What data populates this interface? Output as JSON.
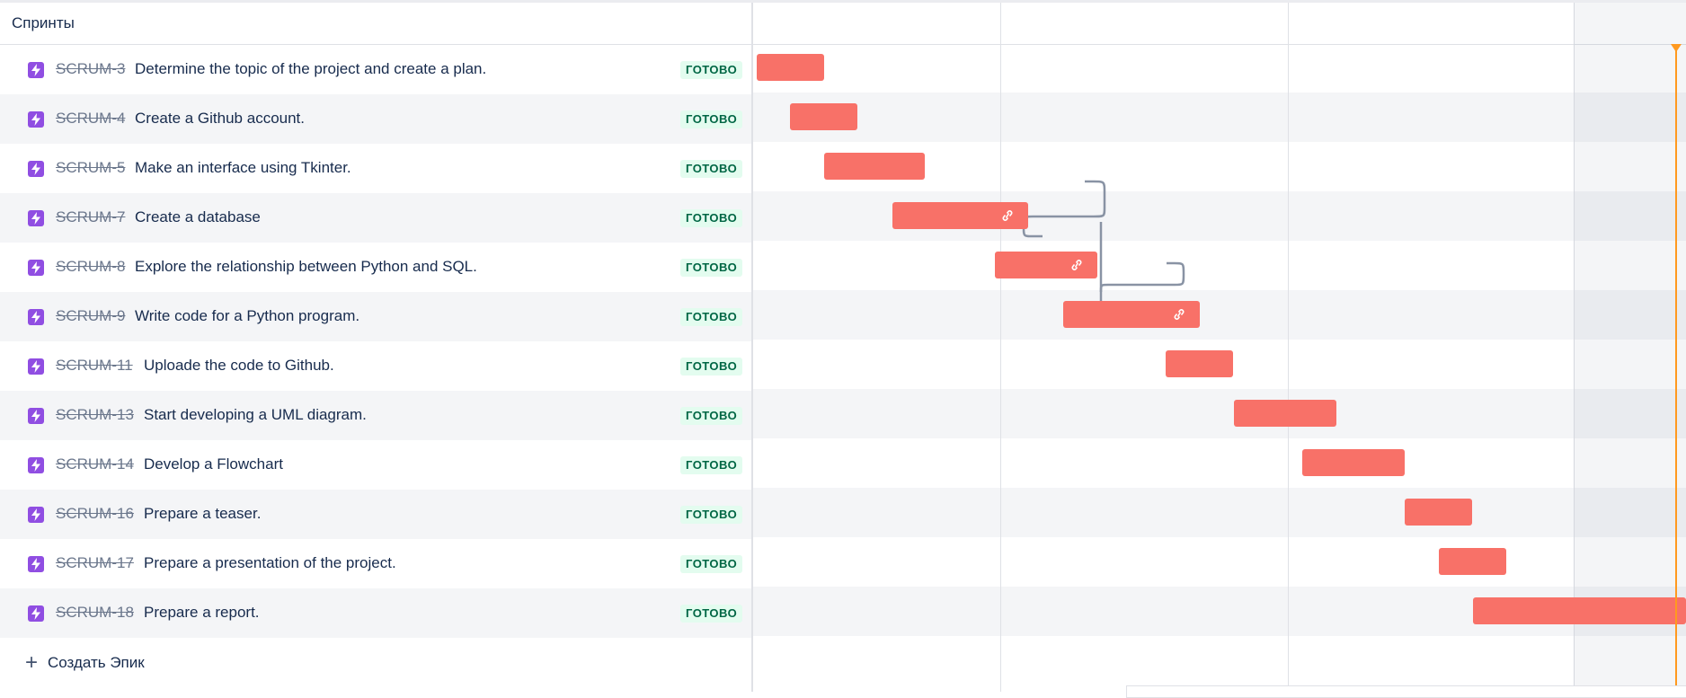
{
  "list_header": "Спринты",
  "status_done": "ГОТОВО",
  "create_epic_label": "Создать Эпик",
  "issue_icon": "epic-lightning-icon",
  "link_icon": "link-icon",
  "colors": {
    "bar": "#f87168",
    "epic_icon": "#904ee2",
    "today": "#ff991f",
    "status_bg": "#e3fcef",
    "status_text": "#006644"
  },
  "issues": [
    {
      "key": "SCRUM-3",
      "summary": "Determine the topic of the project and create a plan.",
      "status": "ГОТОВО",
      "linked": false
    },
    {
      "key": "SCRUM-4",
      "summary": "Create a Github account.",
      "status": "ГОТОВО",
      "linked": false
    },
    {
      "key": "SCRUM-5",
      "summary": "Make an interface using Tkinter.",
      "status": "ГОТОВО",
      "linked": false
    },
    {
      "key": "SCRUM-7",
      "summary": "Create a database",
      "status": "ГОТОВО",
      "linked": true
    },
    {
      "key": "SCRUM-8",
      "summary": "Explore the relationship between Python and SQL.",
      "status": "ГОТОВО",
      "linked": true
    },
    {
      "key": "SCRUM-9",
      "summary": "Write code for a Python program.",
      "status": "ГОТОВО",
      "linked": true
    },
    {
      "key": "SCRUM-11",
      "summary": "Uploade the code to Github.",
      "status": "ГОТОВО",
      "linked": false
    },
    {
      "key": "SCRUM-13",
      "summary": "Start developing a UML diagram.",
      "status": "ГОТОВО",
      "linked": false
    },
    {
      "key": "SCRUM-14",
      "summary": "Develop a Flowchart",
      "status": "ГОТОВО",
      "linked": false
    },
    {
      "key": "SCRUM-16",
      "summary": "Prepare a teaser.",
      "status": "ГОТОВО",
      "linked": false
    },
    {
      "key": "SCRUM-17",
      "summary": "Prepare a presentation of the project.",
      "status": "ГОТОВО",
      "linked": false
    },
    {
      "key": "SCRUM-18",
      "summary": "Prepare a report.",
      "status": "ГОТОВО",
      "linked": false
    }
  ]
}
